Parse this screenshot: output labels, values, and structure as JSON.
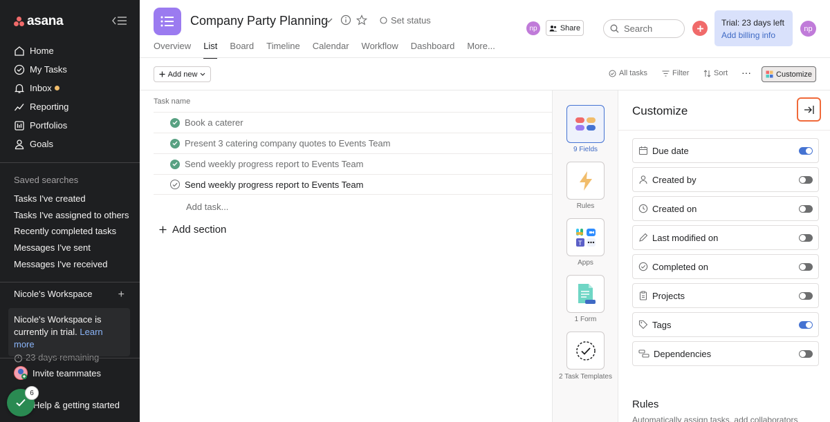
{
  "sidebar": {
    "logo_text": "asana",
    "nav": [
      {
        "label": "Home",
        "icon": "home-icon"
      },
      {
        "label": "My Tasks",
        "icon": "check-circle-icon"
      },
      {
        "label": "Inbox",
        "icon": "bell-icon"
      },
      {
        "label": "Reporting",
        "icon": "chart-icon"
      },
      {
        "label": "Portfolios",
        "icon": "portfolio-icon"
      },
      {
        "label": "Goals",
        "icon": "person-icon"
      }
    ],
    "saved_title": "Saved searches",
    "saved": [
      "Tasks I've created",
      "Tasks I've assigned to others",
      "Recently completed tasks",
      "Messages I've sent",
      "Messages I've received"
    ],
    "workspace_name": "Nicole's Workspace",
    "workspace_plus": "+",
    "trial_text": "Nicole's Workspace is currently in trial.",
    "trial_link": "Learn more",
    "trial_remaining": "23 days remaining",
    "invite": "Invite teammates",
    "help": "Help & getting started",
    "help_badge": "6"
  },
  "header": {
    "project_title": "Company Party Planning",
    "set_status": "Set status",
    "tabs": [
      "Overview",
      "List",
      "Board",
      "Timeline",
      "Calendar",
      "Workflow",
      "Dashboard",
      "More..."
    ],
    "active_tab": "List",
    "avatar_initials": "np",
    "share": "Share",
    "search_placeholder": "Search",
    "trial_badge_line1": "Trial: 23 days left",
    "trial_badge_line2": "Add billing info"
  },
  "toolbar": {
    "add_new": "Add new",
    "all_tasks": "All tasks",
    "filter": "Filter",
    "sort": "Sort",
    "more": "···",
    "customize": "Customize"
  },
  "tasks": {
    "column_header": "Task name",
    "rows": [
      {
        "name": "Book a caterer",
        "done": true
      },
      {
        "name": "Present 3 catering company quotes to Events Team",
        "done": true
      },
      {
        "name": "Send weekly progress report to Events Team",
        "done": true
      },
      {
        "name": "Send weekly progress report to Events Team",
        "done": false
      }
    ],
    "add_task": "Add task...",
    "add_section": "Add section"
  },
  "side_tiles": [
    {
      "label": "9 Fields",
      "icon": "fields-icon",
      "active": true
    },
    {
      "label": "Rules",
      "icon": "lightning-icon",
      "active": false
    },
    {
      "label": "Apps",
      "icon": "apps-icon",
      "active": false
    },
    {
      "label": "1 Form",
      "icon": "form-icon",
      "active": false
    },
    {
      "label": "2 Task Templates",
      "icon": "task-template-icon",
      "active": false
    }
  ],
  "customize_panel": {
    "title": "Customize",
    "fields": [
      {
        "label": "Due date",
        "icon": "calendar-icon",
        "on": true
      },
      {
        "label": "Created by",
        "icon": "person-icon",
        "on": false
      },
      {
        "label": "Created on",
        "icon": "clock-icon",
        "on": false
      },
      {
        "label": "Last modified on",
        "icon": "pencil-icon",
        "on": false
      },
      {
        "label": "Completed on",
        "icon": "check-circle-icon",
        "on": false
      },
      {
        "label": "Projects",
        "icon": "clipboard-icon",
        "on": false
      },
      {
        "label": "Tags",
        "icon": "tag-icon",
        "on": true
      },
      {
        "label": "Dependencies",
        "icon": "dependencies-icon",
        "on": false
      }
    ],
    "rules_title": "Rules",
    "rules_desc": "Automatically assign tasks, add collaborators"
  },
  "colors": {
    "sidebar_bg": "#1e1f21",
    "accent_blue": "#4573d2",
    "brand_coral": "#f06a6a",
    "project_purple": "#9b7bf0",
    "complete_green": "#58a182",
    "highlight_orange": "#f06a3a"
  }
}
